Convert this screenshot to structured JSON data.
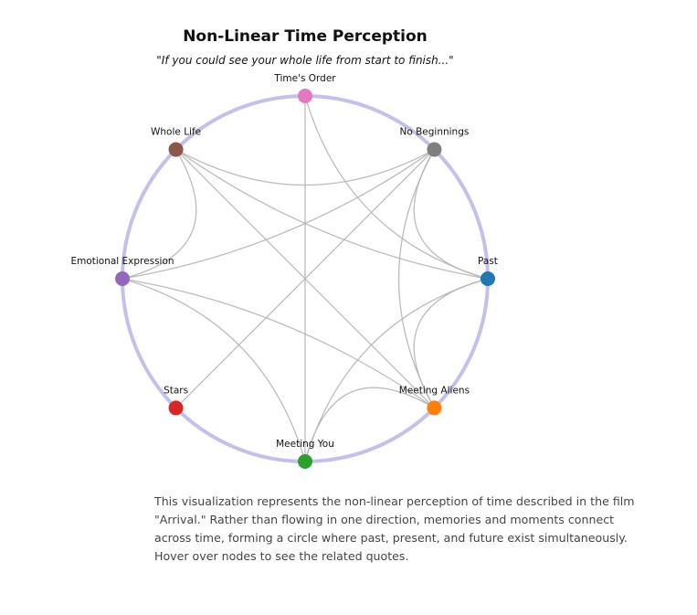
{
  "title": "Non-Linear Time Perception",
  "subtitle": "\"If you could see your whole life from start to finish...\"",
  "ring_color": "#c3c1ea",
  "link_color": "#b5b5b5",
  "nodes": [
    {
      "id": "times-order",
      "label": "Time's Order",
      "color": "#e377c2"
    },
    {
      "id": "no-beginnings",
      "label": "No Beginnings",
      "color": "#7f7f7f"
    },
    {
      "id": "past",
      "label": "Past",
      "color": "#1f77b4"
    },
    {
      "id": "meeting-aliens",
      "label": "Meeting Aliens",
      "color": "#ff7f0e"
    },
    {
      "id": "meeting-you",
      "label": "Meeting You",
      "color": "#2ca02c"
    },
    {
      "id": "stars",
      "label": "Stars",
      "color": "#d62728"
    },
    {
      "id": "emotional-expression",
      "label": "Emotional Expression",
      "color": "#9467bd"
    },
    {
      "id": "whole-life",
      "label": "Whole Life",
      "color": "#8c564b"
    }
  ],
  "links": [
    [
      "times-order",
      "past"
    ],
    [
      "times-order",
      "meeting-you"
    ],
    [
      "whole-life",
      "no-beginnings"
    ],
    [
      "whole-life",
      "past"
    ],
    [
      "whole-life",
      "meeting-aliens"
    ],
    [
      "whole-life",
      "emotional-expression"
    ],
    [
      "no-beginnings",
      "past"
    ],
    [
      "no-beginnings",
      "meeting-aliens"
    ],
    [
      "no-beginnings",
      "stars"
    ],
    [
      "no-beginnings",
      "emotional-expression"
    ],
    [
      "past",
      "meeting-aliens"
    ],
    [
      "past",
      "meeting-you"
    ],
    [
      "meeting-aliens",
      "meeting-you"
    ],
    [
      "meeting-aliens",
      "emotional-expression"
    ],
    [
      "meeting-you",
      "emotional-expression"
    ]
  ],
  "description": "This visualization represents the non-linear perception of time described in the film \"Arrival.\" Rather than flowing in one direction, memories and moments connect across time, forming a circle where past, present, and future exist simultaneously. Hover over nodes to see the related quotes."
}
